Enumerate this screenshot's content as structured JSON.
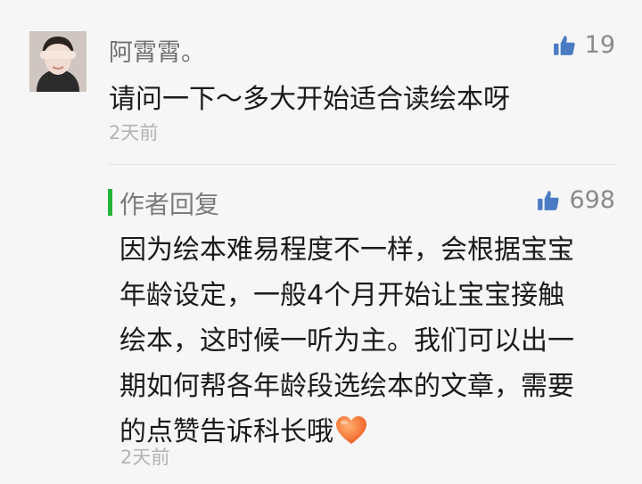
{
  "comment": {
    "username": "阿霄霄。",
    "text": "请问一下～多大开始适合读绘本呀",
    "time": "2天前",
    "likes": "19"
  },
  "reply": {
    "label": "作者回复",
    "lines": [
      "因为绘本难易程度不一样，会根据宝宝",
      "年龄设定，一般4个月开始让宝宝接触",
      "绘本，这时候一听为主。我们可以出一",
      "期如何帮各年龄段选绘本的文章，需要",
      "的点赞告诉科长哦"
    ],
    "time": "2天前",
    "likes": "698"
  },
  "colors": {
    "accent_bar": "#23b53a",
    "like_icon": "#4a7cc4",
    "heart": "#f26a2e"
  },
  "icons": [
    "thumbs-up-icon",
    "heart-emoji-icon"
  ]
}
